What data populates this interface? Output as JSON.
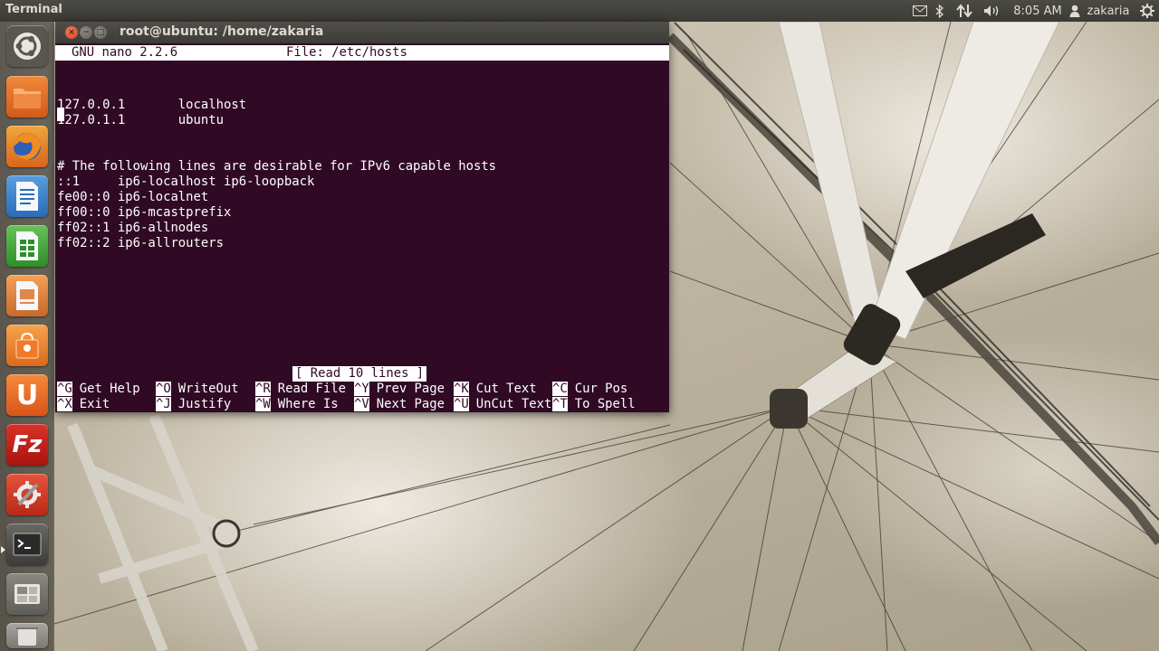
{
  "top_panel": {
    "app_title": "Terminal",
    "clock": "8:05 AM",
    "user": "zakaria",
    "icons": [
      "mail-icon",
      "bluetooth-icon",
      "network-icon",
      "volume-icon",
      "user-icon",
      "gear-icon"
    ]
  },
  "launcher": {
    "items": [
      {
        "name": "dash-home",
        "icon": "ubuntu-logo-icon"
      },
      {
        "name": "files",
        "icon": "folder-icon"
      },
      {
        "name": "firefox",
        "icon": "firefox-icon"
      },
      {
        "name": "libreoffice-writer",
        "icon": "writer-icon"
      },
      {
        "name": "libreoffice-calc",
        "icon": "calc-icon"
      },
      {
        "name": "libreoffice-impress",
        "icon": "impress-icon"
      },
      {
        "name": "software-center",
        "icon": "shopping-bag-icon"
      },
      {
        "name": "ubuntu-one",
        "icon": "ubuntu-one-icon"
      },
      {
        "name": "filezilla",
        "icon": "filezilla-icon"
      },
      {
        "name": "system-settings",
        "icon": "settings-icon"
      },
      {
        "name": "terminal",
        "icon": "terminal-icon"
      },
      {
        "name": "workspace-switcher",
        "icon": "workspace-icon"
      },
      {
        "name": "trash",
        "icon": "trash-icon"
      }
    ],
    "filezilla_label": "Fz",
    "ubuntu_one_label": "U"
  },
  "window": {
    "title": "root@ubuntu: /home/zakaria",
    "close_glyph": "×",
    "min_glyph": "−",
    "max_glyph": "□"
  },
  "nano": {
    "version": "GNU nano 2.2.6",
    "file": "File: /etc/hosts",
    "lines": [
      "127.0.0.1       localhost",
      "127.0.1.1       ubuntu",
      "",
      "",
      "# The following lines are desirable for IPv6 capable hosts",
      "::1     ip6-localhost ip6-loopback",
      "fe00::0 ip6-localnet",
      "ff00::0 ip6-mcastprefix",
      "ff02::1 ip6-allnodes",
      "ff02::2 ip6-allrouters"
    ],
    "status": "[ Read 10 lines ]",
    "shortcuts_row1": [
      {
        "key": "^G",
        "label": "Get Help"
      },
      {
        "key": "^O",
        "label": "WriteOut"
      },
      {
        "key": "^R",
        "label": "Read File"
      },
      {
        "key": "^Y",
        "label": "Prev Page"
      },
      {
        "key": "^K",
        "label": "Cut Text"
      },
      {
        "key": "^C",
        "label": "Cur Pos"
      }
    ],
    "shortcuts_row2": [
      {
        "key": "^X",
        "label": "Exit"
      },
      {
        "key": "^J",
        "label": "Justify"
      },
      {
        "key": "^W",
        "label": "Where Is"
      },
      {
        "key": "^V",
        "label": "Next Page"
      },
      {
        "key": "^U",
        "label": "UnCut Text"
      },
      {
        "key": "^T",
        "label": "To Spell"
      }
    ]
  },
  "colors": {
    "terminal_bg": "#300a24",
    "terminal_fg": "#ffffff",
    "panel_bg": "#3c3b37",
    "close_button": "#df4a21"
  }
}
